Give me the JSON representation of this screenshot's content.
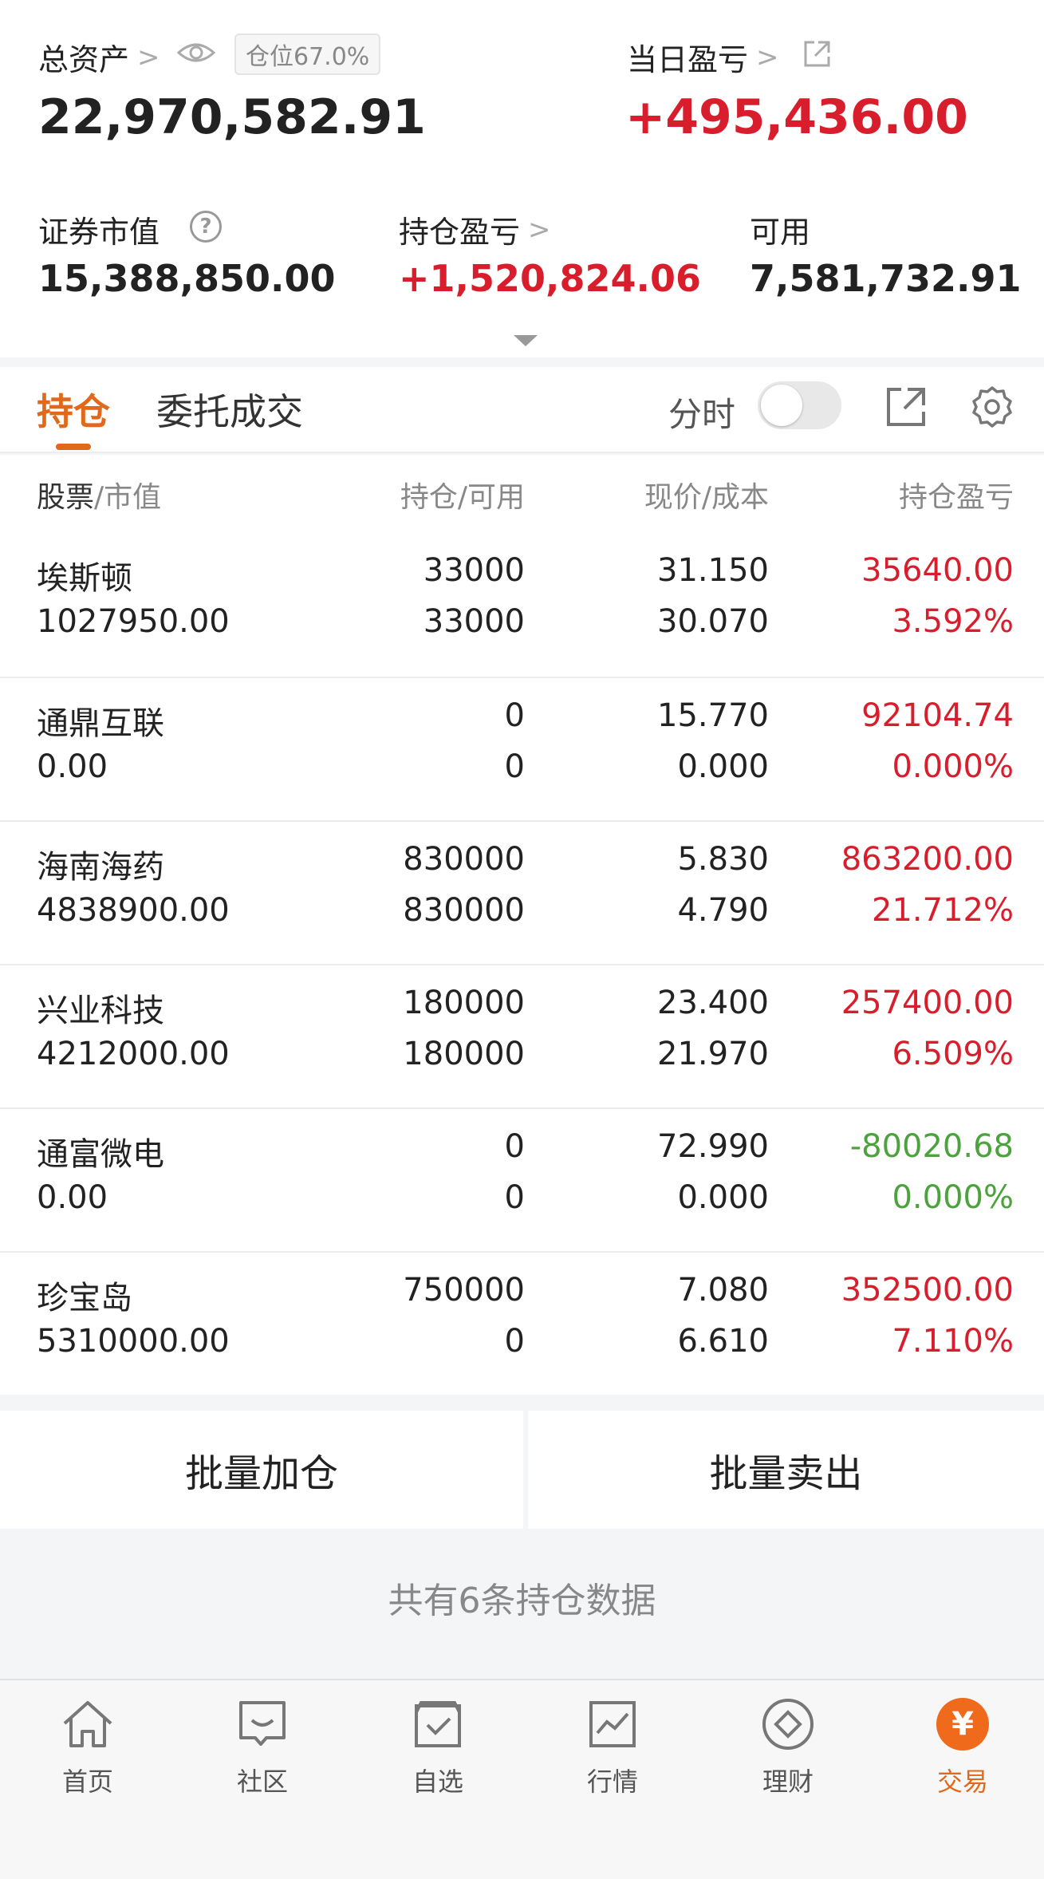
{
  "summary": {
    "total_assets_label": "总资产",
    "position_ratio": "仓位67.0%",
    "total_assets_value": "22,970,582.91",
    "daily_pnl_label": "当日盈亏",
    "daily_pnl_value": "+495,436.00",
    "market_value_label": "证券市值",
    "market_value": "15,388,850.00",
    "holding_pnl_label": "持仓盈亏",
    "holding_pnl_value": "+1,520,824.06",
    "available_label": "可用",
    "available_value": "7,581,732.91"
  },
  "tabs": {
    "holdings": "持仓",
    "orders": "委托成交",
    "intraday_label": "分时",
    "intraday_on": false
  },
  "table": {
    "headers": {
      "stock": "股票",
      "market_value": "市值",
      "position": "持仓",
      "available": "可用",
      "price": "现价",
      "cost": "成本",
      "pnl": "持仓盈亏"
    },
    "rows": [
      {
        "name": "埃斯顿",
        "value": "1027950.00",
        "position": "33000",
        "available": "33000",
        "price": "31.150",
        "cost": "30.070",
        "pnl": "35640.00",
        "pnl_pct": "3.592%",
        "color": "#d81e2c"
      },
      {
        "name": "通鼎互联",
        "value": "0.00",
        "position": "0",
        "available": "0",
        "price": "15.770",
        "cost": "0.000",
        "pnl": "92104.74",
        "pnl_pct": "0.000%",
        "color": "#d81e2c"
      },
      {
        "name": "海南海药",
        "value": "4838900.00",
        "position": "830000",
        "available": "830000",
        "price": "5.830",
        "cost": "4.790",
        "pnl": "863200.00",
        "pnl_pct": "21.712%",
        "color": "#d81e2c"
      },
      {
        "name": "兴业科技",
        "value": "4212000.00",
        "position": "180000",
        "available": "180000",
        "price": "23.400",
        "cost": "21.970",
        "pnl": "257400.00",
        "pnl_pct": "6.509%",
        "color": "#d81e2c"
      },
      {
        "name": "通富微电",
        "value": "0.00",
        "position": "0",
        "available": "0",
        "price": "72.990",
        "cost": "0.000",
        "pnl": "-80020.68",
        "pnl_pct": "0.000%",
        "color": "#4ca23c"
      },
      {
        "name": "珍宝岛",
        "value": "5310000.00",
        "position": "750000",
        "available": "0",
        "price": "7.080",
        "cost": "6.610",
        "pnl": "352500.00",
        "pnl_pct": "7.110%",
        "color": "#d81e2c"
      }
    ]
  },
  "actions": {
    "batch_add": "批量加仓",
    "batch_sell": "批量卖出"
  },
  "footer_text": "共有6条持仓数据",
  "nav": {
    "home": "首页",
    "community": "社区",
    "watchlist": "自选",
    "market": "行情",
    "wealth": "理财",
    "trade": "交易",
    "trade_icon_glyph": "¥"
  },
  "colors": {
    "accent": "#e1691b",
    "gain": "#d81e2c",
    "loss": "#4ca23c"
  }
}
